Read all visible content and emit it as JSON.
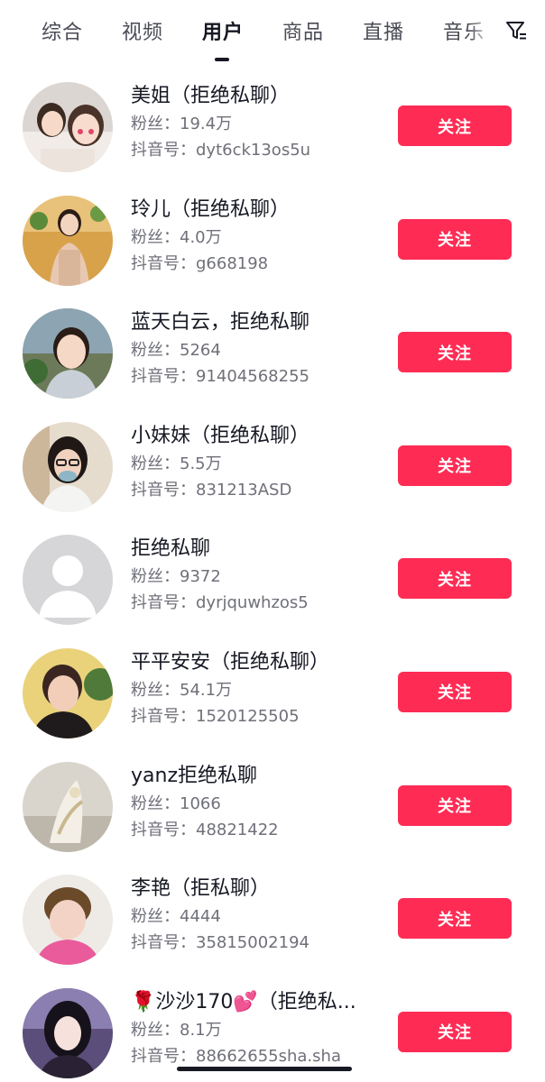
{
  "tabs": [
    {
      "label": "综合",
      "active": false
    },
    {
      "label": "视频",
      "active": false
    },
    {
      "label": "用户",
      "active": true
    },
    {
      "label": "商品",
      "active": false
    },
    {
      "label": "直播",
      "active": false
    },
    {
      "label": "音乐",
      "active": false
    }
  ],
  "filter_icon": "filter-icon",
  "accent_color": "#fe2c55",
  "users": [
    {
      "name": "美姐（拒绝私聊）",
      "fans": "粉丝：19.4万",
      "id": "抖音号：dyt6ck13os5u",
      "follow_label": "关注"
    },
    {
      "name": "玲儿（拒绝私聊）",
      "fans": "粉丝：4.0万",
      "id": "抖音号：g668198",
      "follow_label": "关注"
    },
    {
      "name": "蓝天白云，拒绝私聊",
      "fans": "粉丝：5264",
      "id": "抖音号：91404568255",
      "follow_label": "关注"
    },
    {
      "name": "小妹妹（拒绝私聊）",
      "fans": "粉丝：5.5万",
      "id": "抖音号：831213ASD",
      "follow_label": "关注"
    },
    {
      "name": "拒绝私聊",
      "fans": "粉丝：9372",
      "id": "抖音号：dyrjquwhzos5",
      "follow_label": "关注"
    },
    {
      "name": "平平安安（拒绝私聊）",
      "fans": "粉丝：54.1万",
      "id": "抖音号：1520125505",
      "follow_label": "关注"
    },
    {
      "name": "yanz拒绝私聊",
      "fans": "粉丝：1066",
      "id": "抖音号：48821422",
      "follow_label": "关注"
    },
    {
      "name": "李艳（拒私聊）",
      "fans": "粉丝：4444",
      "id": "抖音号：35815002194",
      "follow_label": "关注"
    },
    {
      "name": "🌹沙沙170💕（拒绝私...",
      "fans": "粉丝：8.1万",
      "id": "抖音号：88662655sha.sha",
      "follow_label": "关注"
    }
  ]
}
